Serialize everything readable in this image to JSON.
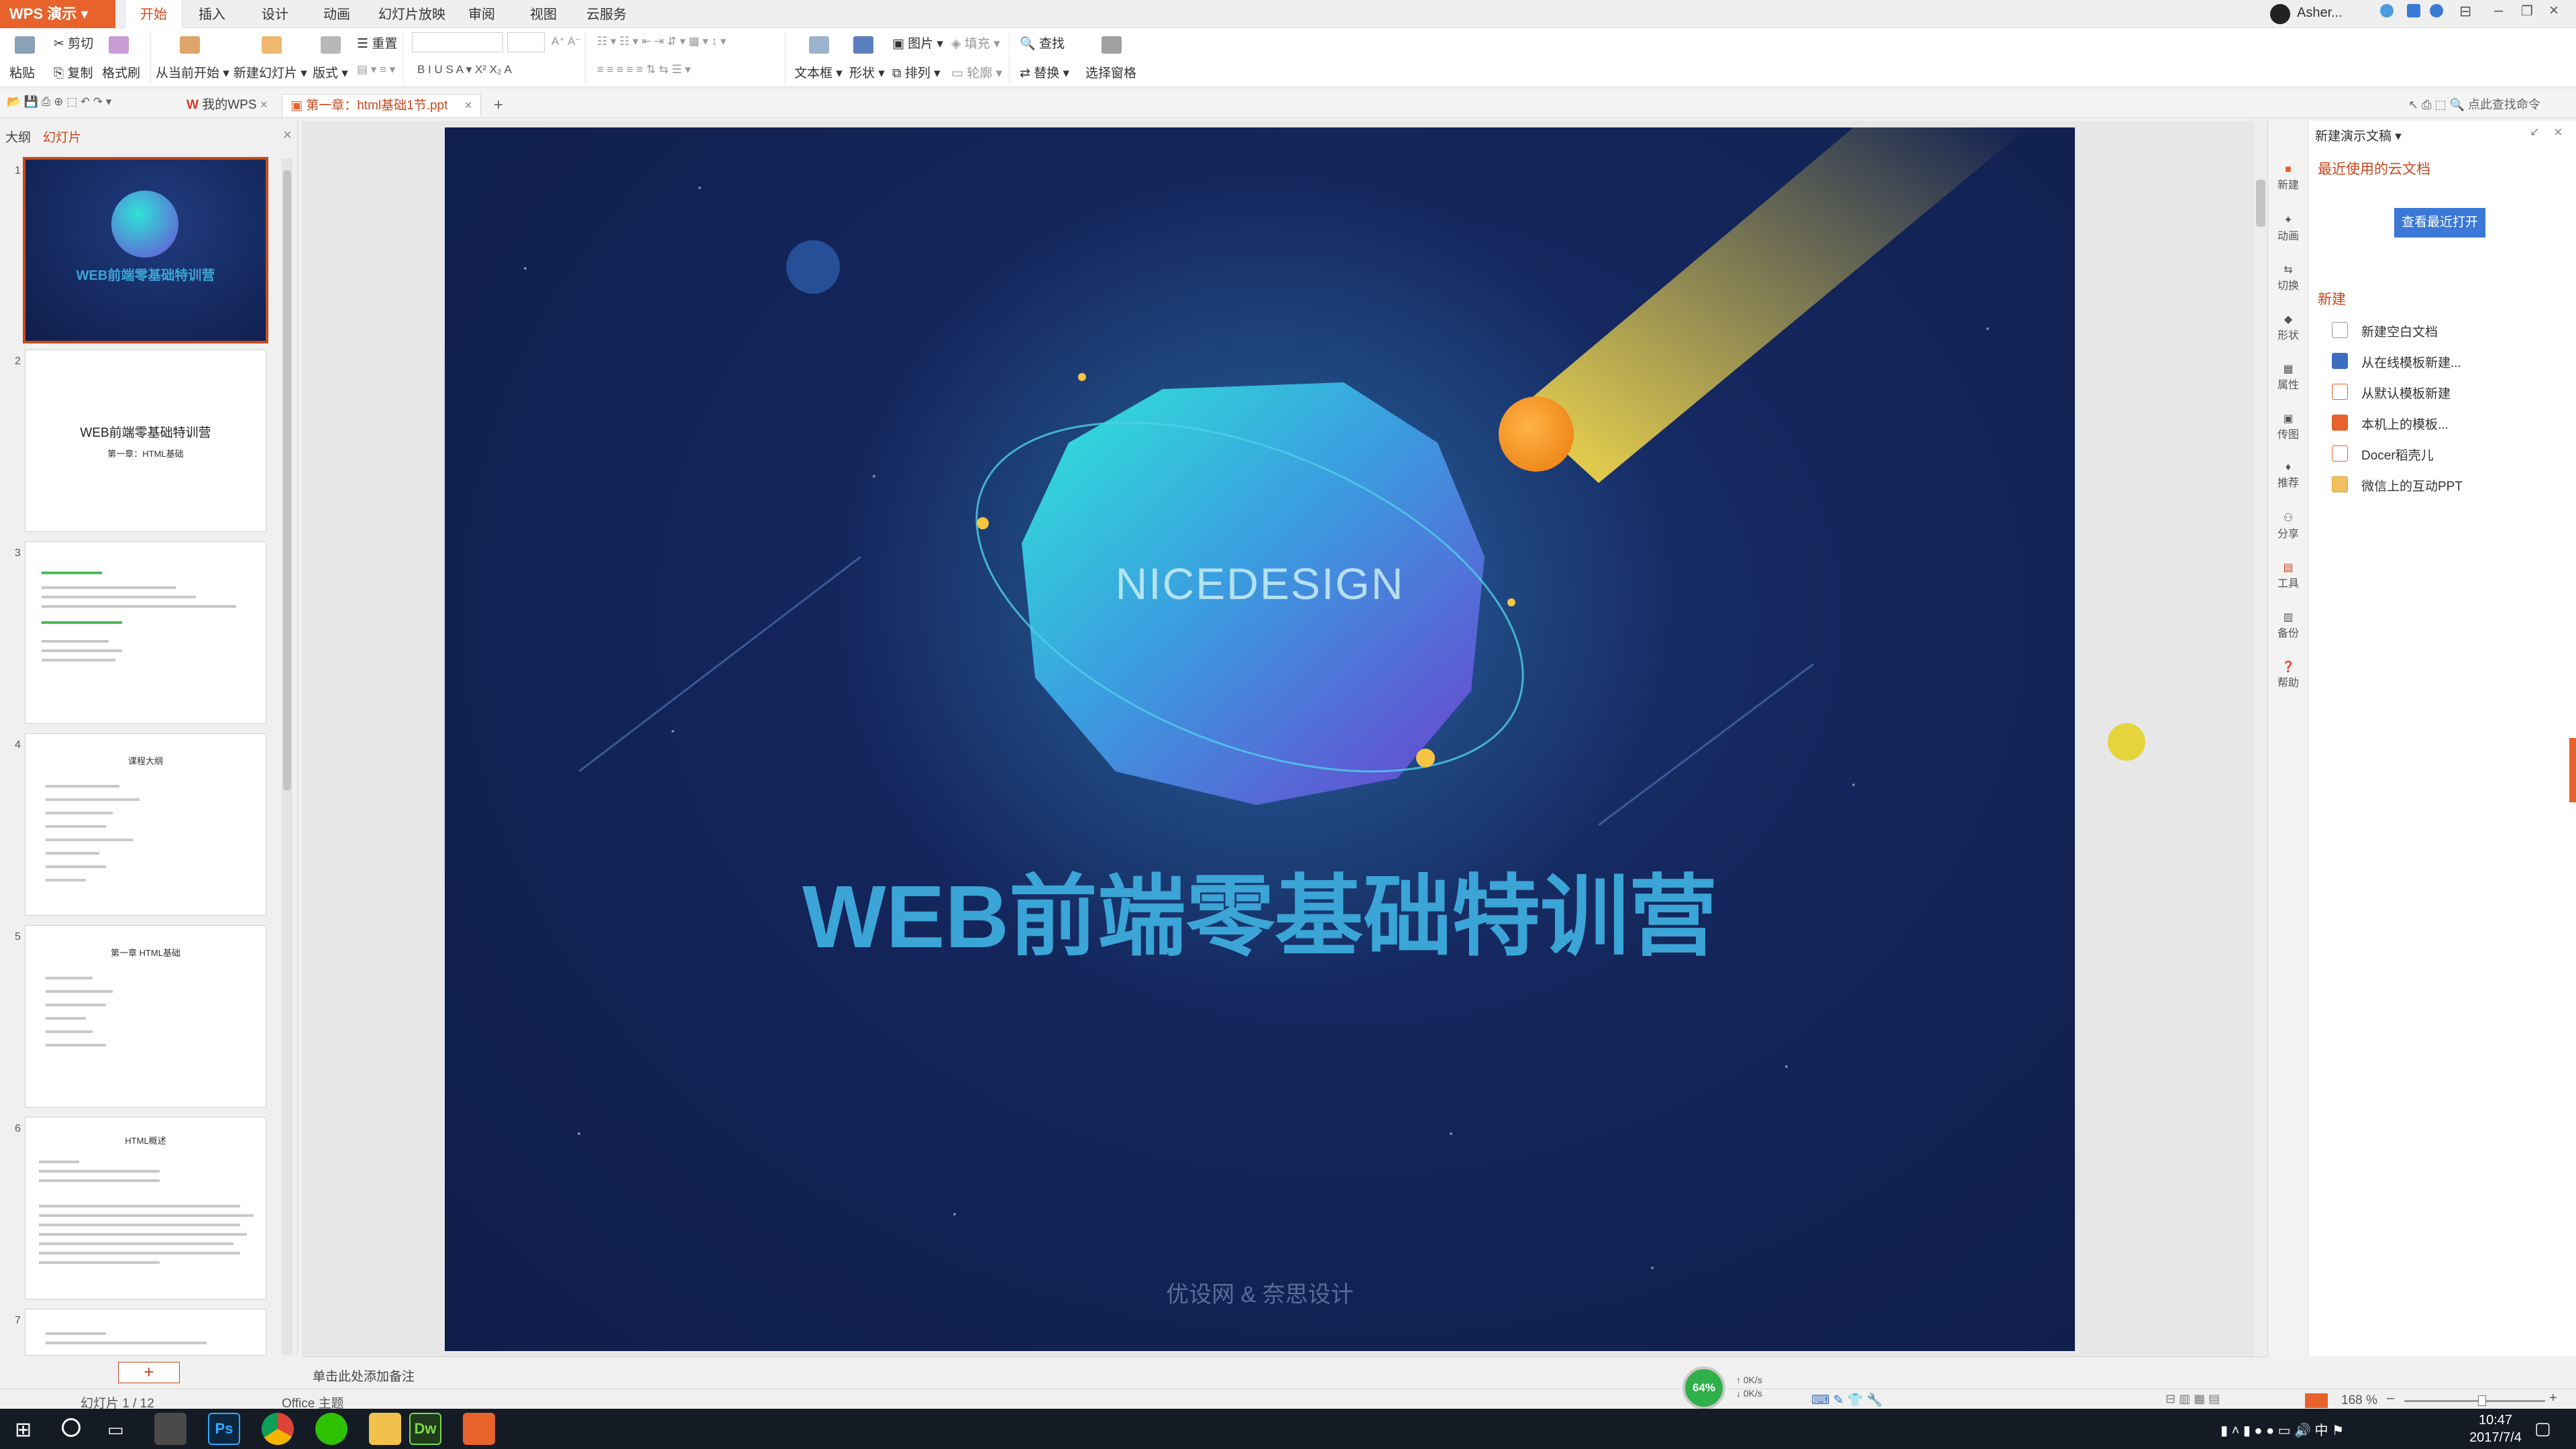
{
  "app": {
    "name": "WPS 演示"
  },
  "menu": [
    "开始",
    "插入",
    "设计",
    "动画",
    "幻灯片放映",
    "审阅",
    "视图",
    "云服务"
  ],
  "user": {
    "name": "Asher..."
  },
  "ribbon": {
    "paste": "粘贴",
    "cut": "剪切",
    "copy": "复制",
    "format_painter": "格式刷",
    "from_current": "从当前开始",
    "new_slide": "新建幻灯片",
    "layout": "版式",
    "reset": "重置",
    "textbox": "文本框",
    "shape": "形状",
    "arrange": "排列",
    "picture": "图片",
    "fill": "填充",
    "outline": "轮廓",
    "find": "查找",
    "replace": "替换",
    "selection_pane": "选择窗格",
    "search_cmd": "点此查找命令"
  },
  "tabs": {
    "mywps": "我的WPS",
    "doc": "第一章：html基础1节.ppt"
  },
  "left_panel": {
    "tab_outline": "大纲",
    "tab_slides": "幻灯片",
    "thumbs": [
      {
        "num": "1",
        "title": "WEB前端零基础特训营"
      },
      {
        "num": "2",
        "title": "WEB前端零基础特训营",
        "subtitle": "第一章：HTML基础"
      },
      {
        "num": "3",
        "title": ""
      },
      {
        "num": "4",
        "title": "课程大纲"
      },
      {
        "num": "5",
        "title": "第一章 HTML基础"
      },
      {
        "num": "6",
        "title": "HTML概述"
      },
      {
        "num": "7",
        "title": ""
      }
    ],
    "add": "+"
  },
  "slide": {
    "logo": "NICEDESIGN",
    "title": "WEB前端零基础特训营",
    "footer": "优设网 & 奈思设计"
  },
  "notes": {
    "placeholder": "单击此处添加备注"
  },
  "status": {
    "slide_count": "幻灯片 1 / 12",
    "theme": "Office 主题",
    "zoom": "168 %",
    "cpu": "64%",
    "net_up": "0K/s",
    "net_down": "0K/s"
  },
  "right_panel": {
    "header": "新建演示文稿",
    "recent_cloud": "最近使用的云文档",
    "view_recent": "查看最近打开",
    "new_title": "新建",
    "new_items": [
      "新建空白文档",
      "从在线模板新建...",
      "从默认模板新建",
      "本机上的模板...",
      "Docer稻壳儿",
      "微信上的互动PPT"
    ]
  },
  "side_icons": [
    "新建",
    "动画",
    "切换",
    "形状",
    "属性",
    "传图",
    "推荐",
    "分享",
    "工具",
    "备份",
    "帮助"
  ],
  "clock": {
    "time": "10:47",
    "date": "2017/7/4"
  },
  "colors": {
    "accent": "#e8622c",
    "slide_bg": "#13255a",
    "title_text": "#3aa5d6"
  }
}
